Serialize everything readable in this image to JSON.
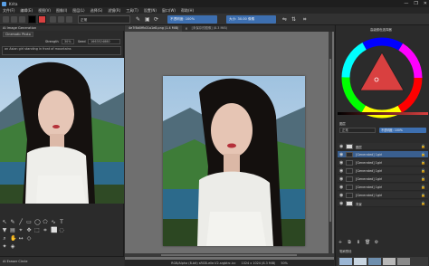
{
  "window": {
    "app_name": "Krita",
    "controls": [
      "—",
      "❐",
      "✕"
    ]
  },
  "menu": [
    "文件(F)",
    "编辑(E)",
    "视图(V)",
    "图像(I)",
    "图层(L)",
    "选择(S)",
    "滤镜(R)",
    "工具(T)",
    "设置(N)",
    "窗口(W)",
    "帮助(H)"
  ],
  "toolbar": {
    "blend_mode": "正常",
    "opacity_label": "不透明度: 100%",
    "size_label": "大小: 30.00 像素",
    "colors": {
      "foreground": "#000000",
      "background": "#ffffff",
      "accent": "#d94040",
      "slider": "#3d6fb0"
    }
  },
  "left_panel": {
    "header": "AI Image Generation",
    "tab_style": "Cinematic Photo",
    "strength_label": "Strength",
    "strength_value": "30%",
    "seed_label": "Seed",
    "seed_value": "1663524880",
    "prompt": "an Asian girl standing in front of mountains",
    "bottom_label": "AI Eraser Circle"
  },
  "document": {
    "tab_title": "4e7f8d0ffb01a1e8.png (1.4 MiB)",
    "second_tab": "[未保存的图像] (8.3 MiB)",
    "close_glyph": "✕"
  },
  "status_bar": {
    "left": "RGB/Alpha (8-bit) sRGB-elle-V2-srgbtrc.icc",
    "center": "1024 x 1024 (8.3 MiB)",
    "zoom": "50%"
  },
  "right_panel": {
    "color_selector_title": "高级颜色选择器",
    "layers_title": "图层",
    "blend_mode": "正常",
    "opacity": "不透明度: 100%",
    "layers": [
      {
        "name": "图层",
        "selected": false,
        "thumb": "light"
      },
      {
        "name": "[Generated] 1girl",
        "selected": true,
        "thumb": "dark"
      },
      {
        "name": "[Generated] 1girl",
        "selected": false,
        "thumb": "dark"
      },
      {
        "name": "[Generated] 1girl",
        "selected": false,
        "thumb": "dark"
      },
      {
        "name": "[Generated] 1girl",
        "selected": false,
        "thumb": "dark"
      },
      {
        "name": "[Generated] 1girl",
        "selected": false,
        "thumb": "dark"
      },
      {
        "name": "[Generated] 1girl",
        "selected": false,
        "thumb": "dark"
      },
      {
        "name": "背景",
        "selected": false,
        "thumb": "light"
      }
    ],
    "layer_buttons": [
      "+",
      "⧉",
      "⬇",
      "🗑",
      "⚙"
    ],
    "brush_presets_title": "笔刷预设"
  },
  "icons": {
    "tools": [
      "pointer-icon",
      "brush-icon",
      "eraser-icon",
      "line-icon",
      "rect-icon",
      "ellipse-icon",
      "polygon-icon",
      "path-icon",
      "text-icon",
      "fill-icon",
      "gradient-icon",
      "picker-icon",
      "move-icon",
      "transform-icon",
      "crop-icon",
      "select-icon"
    ]
  }
}
